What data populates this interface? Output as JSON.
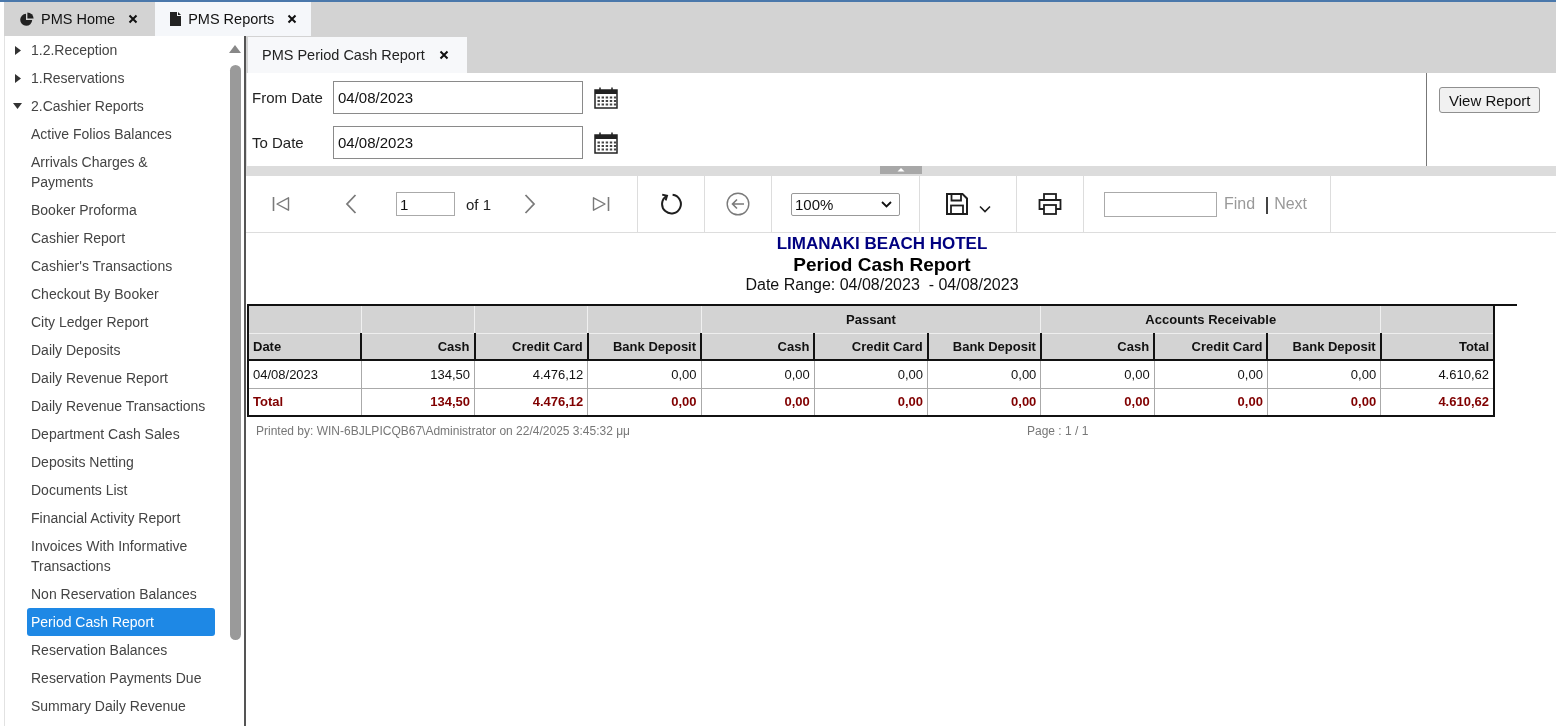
{
  "top_tabs": [
    {
      "label": "PMS Home",
      "kind": "home",
      "selected": false
    },
    {
      "label": "PMS Reports",
      "kind": "reports",
      "selected": true
    }
  ],
  "sidebar": {
    "items": [
      {
        "label": "1.2.Reception",
        "expanded": false
      },
      {
        "label": "1.Reservations",
        "expanded": false
      },
      {
        "label": "2.Cashier Reports",
        "expanded": true,
        "children": [
          {
            "label": "Active Folios Balances",
            "selected": false
          },
          {
            "label": "Arrivals Charges & Payments",
            "selected": false
          },
          {
            "label": "Booker Proforma",
            "selected": false
          },
          {
            "label": "Cashier Report",
            "selected": false
          },
          {
            "label": "Cashier's Transactions",
            "selected": false
          },
          {
            "label": "Checkout By Booker",
            "selected": false
          },
          {
            "label": "City Ledger Report",
            "selected": false
          },
          {
            "label": "Daily Deposits",
            "selected": false
          },
          {
            "label": "Daily Revenue Report",
            "selected": false
          },
          {
            "label": "Daily Revenue Transactions",
            "selected": false
          },
          {
            "label": "Department Cash Sales",
            "selected": false
          },
          {
            "label": "Deposits Netting",
            "selected": false
          },
          {
            "label": "Documents List",
            "selected": false
          },
          {
            "label": "Financial Activity Report",
            "selected": false
          },
          {
            "label": "Invoices With Informative Transactions",
            "selected": false
          },
          {
            "label": "Non Reservation Balances",
            "selected": false
          },
          {
            "label": "Period Cash Report",
            "selected": true
          },
          {
            "label": "Reservation Balances",
            "selected": false
          },
          {
            "label": "Reservation Payments Due",
            "selected": false
          },
          {
            "label": "Summary Daily Revenue",
            "selected": false
          }
        ]
      }
    ]
  },
  "report_tabs": [
    {
      "label": "PMS Period Cash Report",
      "selected": true
    }
  ],
  "parameters": {
    "fields": [
      {
        "label": "From Date",
        "value": "04/08/2023"
      },
      {
        "label": "To Date",
        "value": "04/08/2023"
      }
    ],
    "view_button": "View Report"
  },
  "toolbar": {
    "first_page": {
      "disabled": true
    },
    "previous_page": {
      "disabled": true
    },
    "page_field": {
      "value": "1"
    },
    "page_count": "of 1",
    "next_page": {
      "disabled": true
    },
    "last_page": {
      "disabled": true
    },
    "refresh": {
      "disabled": false
    },
    "back": {
      "disabled": true
    },
    "zoom": {
      "value": "100%"
    },
    "save": {
      "disabled": false
    },
    "print": {
      "disabled": false
    },
    "find": {
      "label": "Find",
      "disabled": true
    },
    "find_next": {
      "label": "Next",
      "disabled": true
    }
  },
  "report": {
    "company": "LIMANAKI BEACH HOTEL",
    "title": "Period Cash Report",
    "date_range": "Date Range: 04/08/2023  - 04/08/2023",
    "table": {
      "columns": [
        {
          "label": "Date"
        },
        {
          "label": "Cash"
        },
        {
          "label": "Credit Card"
        },
        {
          "label": "Bank Deposit"
        },
        {
          "label": "Passant",
          "colspan": 3,
          "children": [
            {
              "label": "Cash"
            },
            {
              "label": "Credit Card"
            },
            {
              "label": "Bank Deposit"
            }
          ]
        },
        {
          "label": "Accounts Receivable",
          "colspan": 3,
          "children": [
            {
              "label": "Cash"
            },
            {
              "label": "Credit Card"
            },
            {
              "label": "Bank Deposit"
            }
          ]
        },
        {
          "label": "Total"
        }
      ],
      "rows": [
        {
          "kind": "data",
          "cells": [
            "04/08/2023",
            "134,50",
            "4.476,12",
            "0,00",
            "0,00",
            "0,00",
            "0,00",
            "0,00",
            "0,00",
            "0,00",
            "4.610,62"
          ]
        },
        {
          "kind": "total",
          "cells": [
            "Total",
            "134,50",
            "4.476,12",
            "0,00",
            "0,00",
            "0,00",
            "0,00",
            "0,00",
            "0,00",
            "0,00",
            "4.610,62"
          ]
        }
      ]
    },
    "footer": {
      "printed_by": "Printed by: WIN-6BJLPICQB67\\Administrator on 22/4/2025 3:45:32 μμ",
      "page": "Page : 1  / 1"
    }
  }
}
